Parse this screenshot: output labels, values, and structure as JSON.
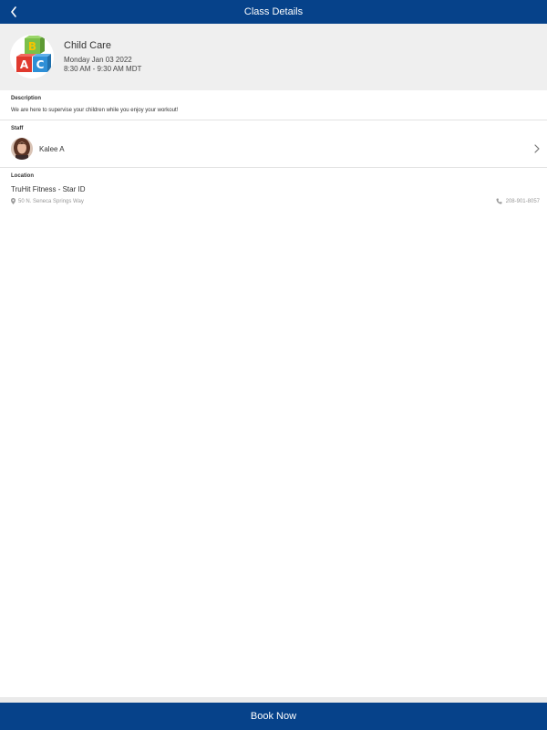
{
  "topbar": {
    "title": "Class Details",
    "back_icon": "chevron-left-icon"
  },
  "class": {
    "logo_icon": "abc-blocks-icon",
    "name": "Child Care",
    "date": "Monday Jan 03 2022",
    "time": "8:30 AM - 9:30 AM MDT"
  },
  "description": {
    "label": "Description",
    "text": "We are here to supervise your children while you enjoy your workout!"
  },
  "staff": {
    "label": "Staff",
    "name": "Kalee A",
    "chevron_icon": "chevron-right-icon"
  },
  "location": {
    "label": "Location",
    "name": "TruHit Fitness - Star ID",
    "address": "50 N. Seneca Springs Way",
    "phone": "208-901-8057",
    "address_icon": "map-pin-icon",
    "phone_icon": "phone-icon"
  },
  "footer": {
    "book_label": "Book Now"
  },
  "colors": {
    "brand": "#06428a",
    "header_bg": "#efefef",
    "muted_text": "#999999"
  }
}
